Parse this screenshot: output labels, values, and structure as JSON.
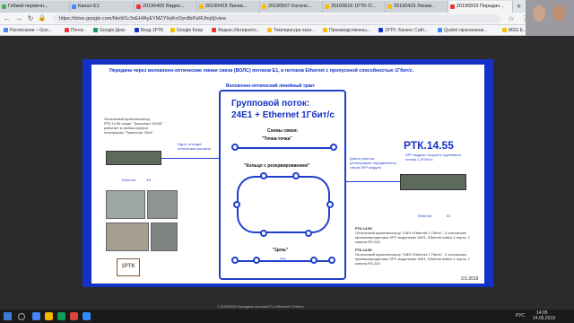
{
  "tabs": [
    {
      "label": "Гибкий первичн..."
    },
    {
      "label": "Канал E1"
    },
    {
      "label": "20190405 Видео..."
    },
    {
      "label": "20190423 Линии..."
    },
    {
      "label": "20190507 Катало..."
    },
    {
      "label": "20160816 1PTK O..."
    },
    {
      "label": "20190423 Линии..."
    },
    {
      "label": "20190503 Передач..."
    }
  ],
  "address_bar": {
    "url": "https://drive.google.com/file/d/1c3oEHfAyEYMZY9qKoOyrdlbPaRUbq9j/view"
  },
  "bookmarks": [
    {
      "label": "Расписание – Goo..."
    },
    {
      "label": "Почта"
    },
    {
      "label": "Google Диск"
    },
    {
      "label": "Вход 1PTK"
    },
    {
      "label": "Google Keep"
    },
    {
      "label": "Яндекс.Интернето..."
    },
    {
      "label": "Температура окол..."
    },
    {
      "label": "Производственны..."
    },
    {
      "label": "1PTK: Бизнес Сайт..."
    },
    {
      "label": "Quizlet проклеиени..."
    },
    {
      "label": "MSG E..."
    }
  ],
  "slide": {
    "title": "Передача через волоконно-оптические линии связи (ВОЛС) потоков Е1, и потоков Ethernet с пропускной способностью 1Гбит/с.",
    "trunk_label": "Волоконно-оптический линейный тракт",
    "group_stream_title": "Групповой поток:",
    "group_stream_value": "24E1 + Ethernet 1Гбит/с",
    "schemes_label": "Схемы связи:",
    "point_to_point": "\"Точка-точка\"",
    "ring": "\"Кольцо с резервированием\"",
    "chain": "\"Цепь\"",
    "ellipsis": "...",
    "left_device_desc": "Оптический мультиплексор РТК.14.55 серии \"Транспорт 32x30\" работает в любом корпусе платформы \"Транспорт 30х4\"",
    "fiber_note": "Одно, или два оптических волокна",
    "ethernet_left": "Ethernet",
    "e1_left": "E1",
    "right_device_title": "РТК.14.55",
    "right_device_desc": "SFP модули Скорость группового потока 1,3Гбит/с",
    "regen_note": "Длина участка регенерации, определяется типом SFP модуля",
    "ethernet_right": "Ethernet",
    "e1_right": "E1",
    "logo_text": "1PTK",
    "note1_title": "РТК.14.55",
    "note1_body": "Оптический мультиплексор \"24E1+Ethernet 1 Гбит/с\", 2 оптических приемопередатчика SFP, выделение 8xE1, Ethernet switch 4 порта, 2 канала RS-232.",
    "note2_title": "РТК.14.56",
    "note2_body": "Оптический мультиплексор \"24E1+Ethernet 1 Гбит/с\", 2 оптических приемопередатчика SFP, выделение 8xE1, Ethernet switch 4 порта, 2 канала RS-232.",
    "date": "3.5.2019"
  },
  "viewer_caption": "1 20190503 Передача потоков E1 и Ethernet 1Гбит/с",
  "taskbar": {
    "lang": "РУС",
    "time": "14:05",
    "date": "14.05.2019"
  },
  "colors": {
    "slide_border": "#1432c8",
    "accent": "#1e3fcc"
  }
}
